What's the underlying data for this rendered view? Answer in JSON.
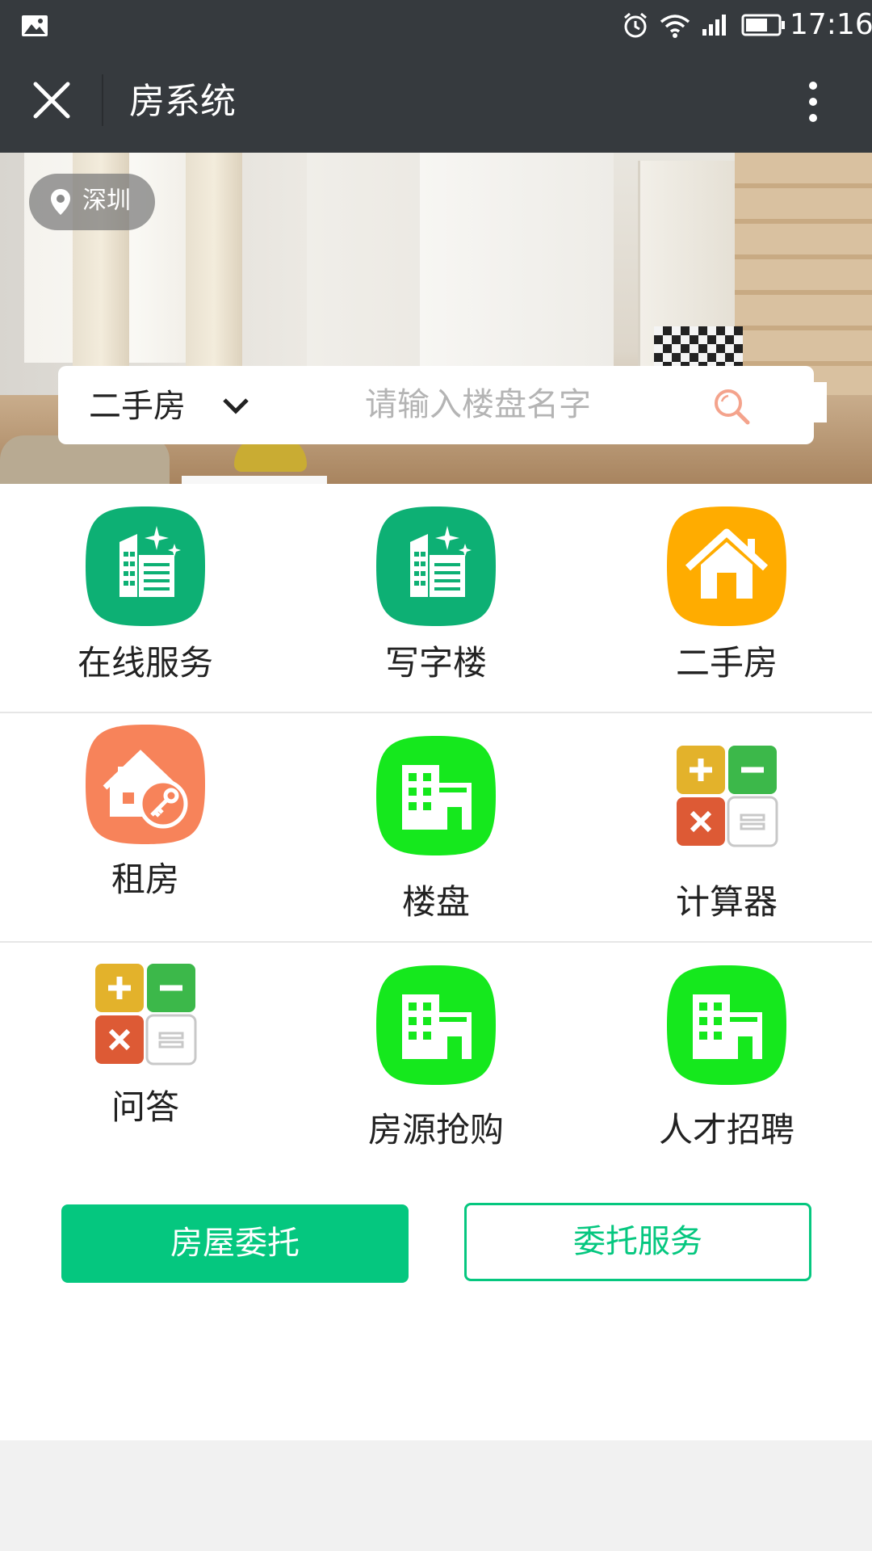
{
  "status_bar": {
    "time": "17:16"
  },
  "title_bar": {
    "title": "房系统"
  },
  "banner": {
    "location": "深圳"
  },
  "search": {
    "type_label": "二手房",
    "placeholder": "请输入楼盘名字",
    "value": ""
  },
  "grid": {
    "rows": [
      [
        {
          "label": "在线服务",
          "icon": "office-building-green-icon"
        },
        {
          "label": "写字楼",
          "icon": "office-building-green-icon"
        },
        {
          "label": "二手房",
          "icon": "house-orange-icon"
        }
      ],
      [
        {
          "label": "租房",
          "icon": "house-key-icon"
        },
        {
          "label": "楼盘",
          "icon": "building-green-icon"
        },
        {
          "label": "计算器",
          "icon": "calculator-icon"
        }
      ],
      [
        {
          "label": "问答",
          "icon": "calculator-icon"
        },
        {
          "label": "房源抢购",
          "icon": "building-green-icon"
        },
        {
          "label": "人才招聘",
          "icon": "building-green-icon"
        }
      ]
    ]
  },
  "actions": {
    "primary_label": "房屋委托",
    "secondary_label": "委托服务"
  },
  "colors": {
    "accent": "#05c77f",
    "dark_bar": "#363a3e",
    "orange": "#ffac00",
    "coral": "#f7835a",
    "bright_green": "#15e81d"
  }
}
